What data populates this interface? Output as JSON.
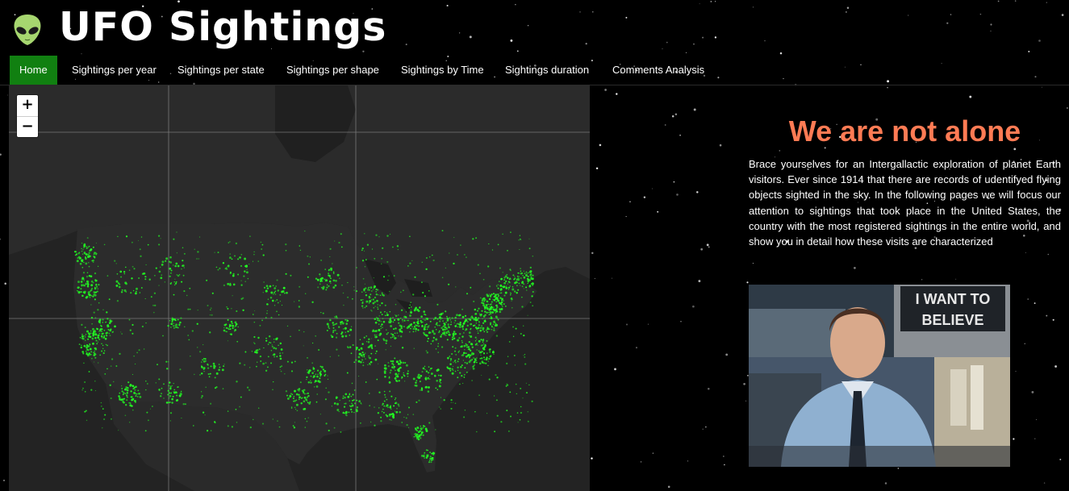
{
  "header": {
    "logo_icon": "alien-icon",
    "title": "UFO Sightings"
  },
  "nav": {
    "items": [
      {
        "label": "Home",
        "active": true
      },
      {
        "label": "Sightings per year",
        "active": false
      },
      {
        "label": "Sightings per state",
        "active": false
      },
      {
        "label": "Sightings per shape",
        "active": false
      },
      {
        "label": "Sightings by Time",
        "active": false
      },
      {
        "label": "Sightings duration",
        "active": false
      },
      {
        "label": "Comments Analysis",
        "active": false
      }
    ],
    "active_color": "#118011"
  },
  "map": {
    "zoom_in_label": "+",
    "zoom_out_label": "−",
    "base_color": "#232323",
    "point_color": "#22ff22"
  },
  "main": {
    "title": "We are not alone",
    "title_color": "#ff7b54",
    "intro": "Brace yourselves for an Intergallactic exploration of planet Earth visitors. Ever since 1914 that there are records of udentifyed flying objects sighted in the sky. In the following pages we will focus our attention to sightings that took place in the United States, the country with the most registered sightings in the entire world, and show you in detail how these visits are characterized",
    "photo_sign_line1": "I WANT TO",
    "photo_sign_line2": "BELIEVE"
  }
}
